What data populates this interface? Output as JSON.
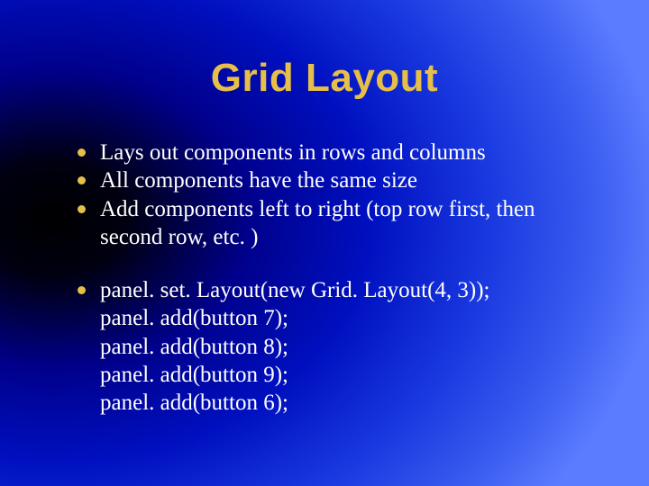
{
  "title": "Grid Layout",
  "groups": [
    {
      "items": [
        "Lays out components in rows and columns",
        "All components have the same size",
        "Add components left to right (top row first, then second row, etc. )"
      ]
    },
    {
      "items": [
        "panel. set. Layout(new Grid. Layout(4, 3));\npanel. add(button 7);\npanel. add(button 8);\npanel. add(button 9);\npanel. add(button 6);"
      ]
    }
  ]
}
